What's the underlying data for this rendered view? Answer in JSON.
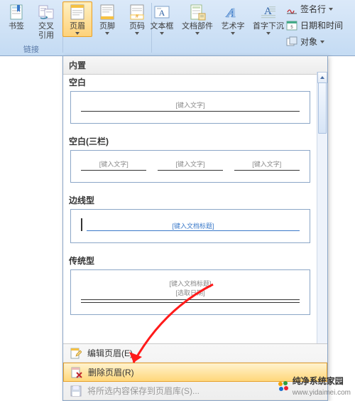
{
  "ribbon": {
    "links_group": "链接",
    "bookmark": "书签",
    "cross_ref": "交叉\n引用",
    "header": "页眉",
    "footer": "页脚",
    "page_num": "页码",
    "textbox": "文本框",
    "quickparts": "文档部件",
    "wordart": "艺术字",
    "dropcap": "首字下沉",
    "signature": "签名行",
    "datetime": "日期和时间",
    "object": "对象"
  },
  "dropdown": {
    "builtin": "内置",
    "opt_blank": "空白",
    "opt_blank3": "空白(三栏)",
    "opt_sideline": "边线型",
    "opt_traditional": "传统型",
    "ph_text": "[键入文字]",
    "ph_doctitle": "[键入文档标题]",
    "ph_date": "[选取日期]",
    "edit": "编辑页眉(E)",
    "remove": "删除页眉(R)",
    "save": "将所选内容保存到页眉库(S)..."
  },
  "watermark": {
    "name": "纯净系统家园",
    "url": "www.yidaimei.com"
  }
}
